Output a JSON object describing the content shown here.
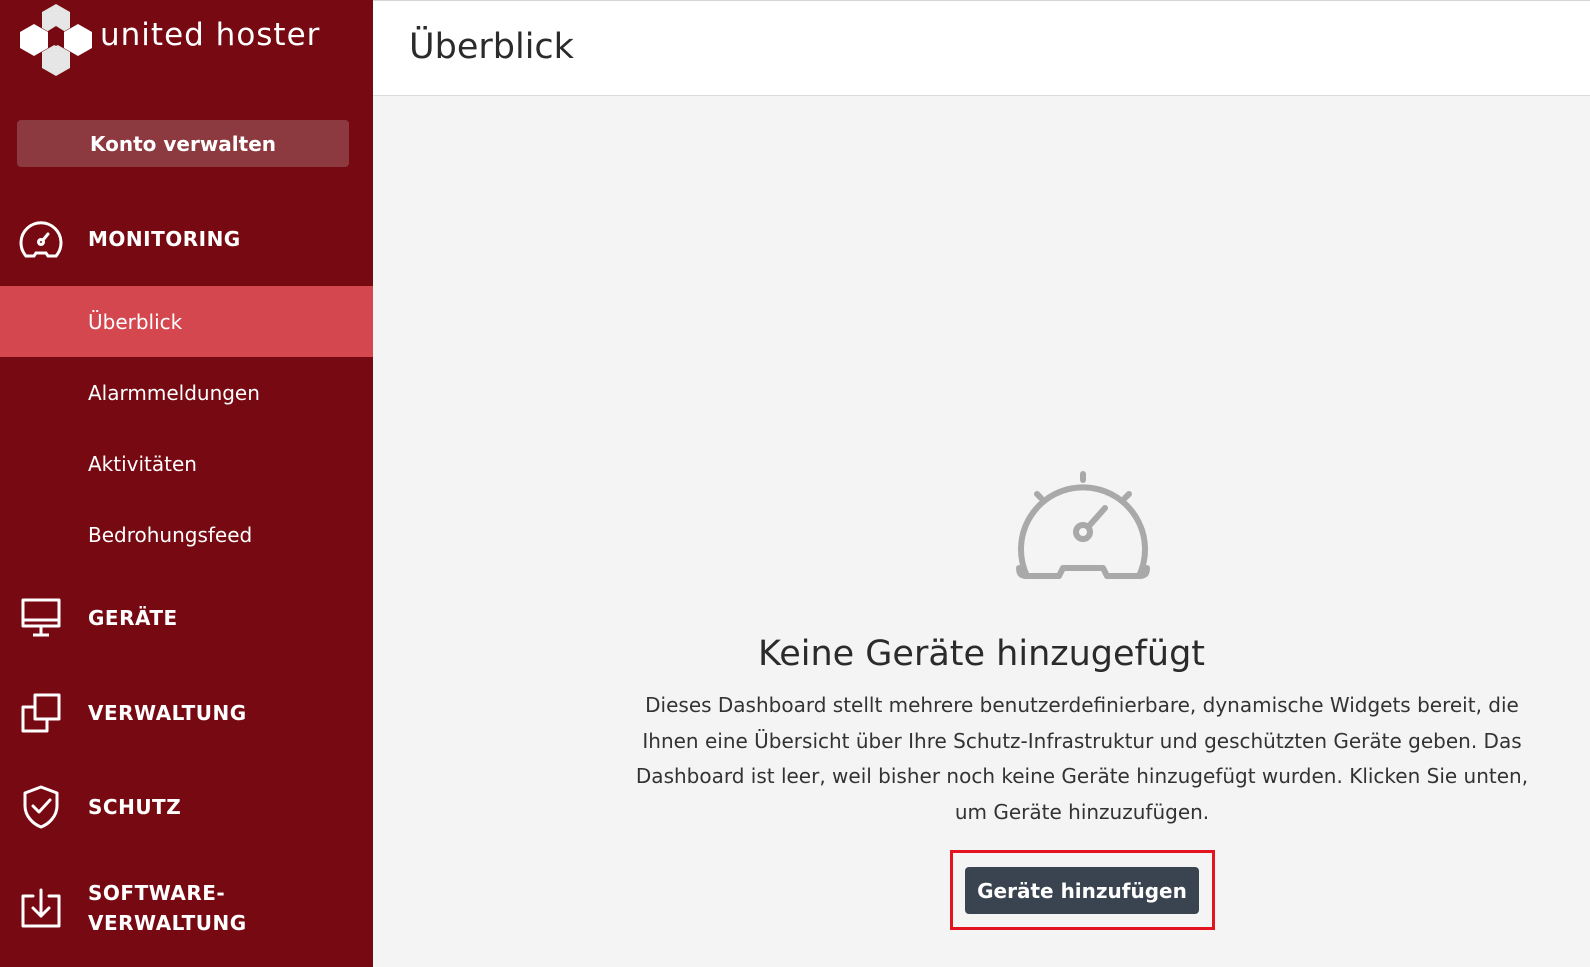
{
  "brand": {
    "logo_text": "united hoster"
  },
  "sidebar": {
    "account_button": "Konto verwalten",
    "sections": [
      {
        "label": "MONITORING",
        "icon": "speedometer-icon"
      },
      {
        "label": "GERÄTE",
        "icon": "monitor-icon"
      },
      {
        "label": "VERWALTUNG",
        "icon": "copy-windows-icon"
      },
      {
        "label": "SCHUTZ",
        "icon": "shield-check-icon"
      },
      {
        "label_line1": "SOFTWARE-",
        "label_line2": "VERWALTUNG",
        "icon": "download-box-icon"
      }
    ],
    "monitoring_items": [
      {
        "label": "Überblick",
        "active": true
      },
      {
        "label": "Alarmmeldungen",
        "active": false
      },
      {
        "label": "Aktivitäten",
        "active": false
      },
      {
        "label": "Bedrohungsfeed",
        "active": false
      }
    ]
  },
  "header": {
    "title": "Überblick"
  },
  "main": {
    "empty_icon": "speedometer-icon",
    "empty_title": "Keine Geräte hinzugefügt",
    "empty_description": "Dieses Dashboard stellt mehrere benutzerdefinierbare, dynamische Widgets bereit, die Ihnen eine Übersicht über Ihre Schutz-Infrastruktur und geschützten Geräte geben. Das Dashboard ist leer, weil bisher noch keine Geräte hinzugefügt wurden. Klicken Sie unten, um Geräte hinzuzufügen.",
    "add_button": "Geräte hinzufügen"
  },
  "colors": {
    "sidebar_bg": "#760912",
    "active_item_bg": "#d4474f",
    "button_bg": "#3a4450",
    "highlight": "#e3141f"
  }
}
